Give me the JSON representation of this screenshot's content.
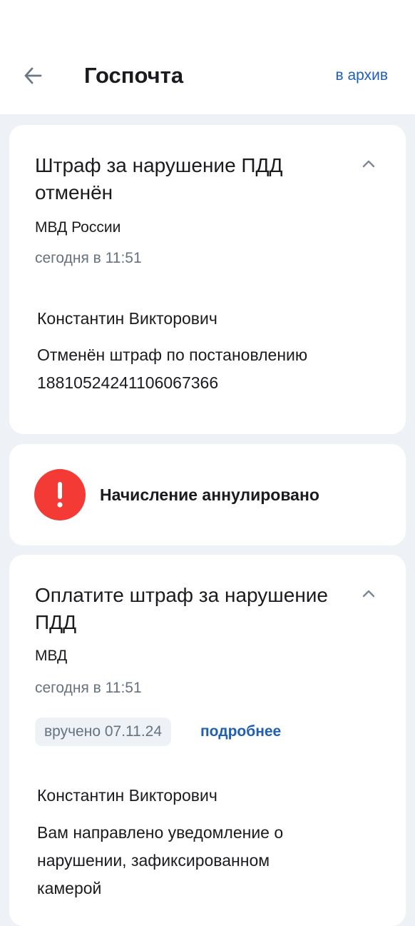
{
  "header": {
    "title": "Госпочта",
    "archive_label": "в архив"
  },
  "messages": [
    {
      "title": "Штраф за нарушение ПДД отменён",
      "sender": "МВД России",
      "date": "сегодня в 11:51",
      "recipient": "Константин Викторович",
      "body": "Отменён штраф по постановлению 18810524241106067366"
    },
    {
      "title": "Оплатите штраф за нарушение ПДД",
      "sender": "МВД",
      "date": "сегодня в 11:51",
      "badge": "вручено 07.11.24",
      "details_label": "подробнее",
      "recipient": "Константин Викторович",
      "body": "Вам направлено уведомление о нарушении, зафиксированном камерой"
    }
  ],
  "status_notice": {
    "text": "Начисление аннулировано",
    "icon": "exclamation-icon",
    "color": "#f33a35"
  },
  "colors": {
    "accent": "#1f5fb4",
    "muted": "#66727f",
    "background": "#eef2f7",
    "alert": "#f33a35"
  }
}
